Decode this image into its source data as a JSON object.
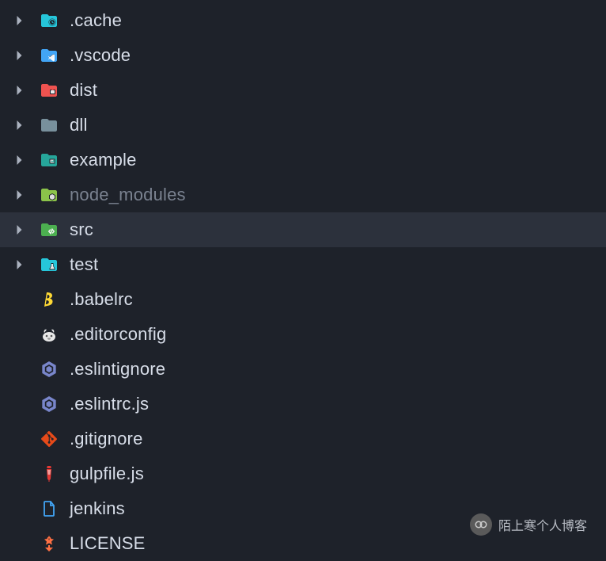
{
  "files": [
    {
      "name": ".cache",
      "type": "folder",
      "icon": "folder-clock",
      "color": "#26c6da",
      "expandable": true,
      "dimmed": false
    },
    {
      "name": ".vscode",
      "type": "folder",
      "icon": "folder-vscode",
      "color": "#42a5f5",
      "expandable": true,
      "dimmed": false
    },
    {
      "name": "dist",
      "type": "folder",
      "icon": "folder-dist",
      "color": "#ef5350",
      "expandable": true,
      "dimmed": false
    },
    {
      "name": "dll",
      "type": "folder",
      "icon": "folder",
      "color": "#78909c",
      "expandable": true,
      "dimmed": false
    },
    {
      "name": "example",
      "type": "folder",
      "icon": "folder-example",
      "color": "#26a69a",
      "expandable": true,
      "dimmed": false
    },
    {
      "name": "node_modules",
      "type": "folder",
      "icon": "folder-node",
      "color": "#8bc34a",
      "expandable": true,
      "dimmed": true
    },
    {
      "name": "src",
      "type": "folder",
      "icon": "folder-src",
      "color": "#4caf50",
      "expandable": true,
      "selected": true,
      "dimmed": false
    },
    {
      "name": "test",
      "type": "folder",
      "icon": "folder-test",
      "color": "#26c6da",
      "expandable": true,
      "dimmed": false
    },
    {
      "name": ".babelrc",
      "type": "file",
      "icon": "babel",
      "color": "#fdd835",
      "expandable": false,
      "dimmed": false
    },
    {
      "name": ".editorconfig",
      "type": "file",
      "icon": "editorconfig",
      "color": "#e8e8e8",
      "expandable": false,
      "dimmed": false
    },
    {
      "name": ".eslintignore",
      "type": "file",
      "icon": "eslint",
      "color": "#7986cb",
      "expandable": false,
      "dimmed": false
    },
    {
      "name": ".eslintrc.js",
      "type": "file",
      "icon": "eslint",
      "color": "#7986cb",
      "expandable": false,
      "dimmed": false
    },
    {
      "name": ".gitignore",
      "type": "file",
      "icon": "git",
      "color": "#e64a19",
      "expandable": false,
      "dimmed": false
    },
    {
      "name": "gulpfile.js",
      "type": "file",
      "icon": "gulp",
      "color": "#e53935",
      "expandable": false,
      "dimmed": false
    },
    {
      "name": "jenkins",
      "type": "file",
      "icon": "file",
      "color": "#42a5f5",
      "expandable": false,
      "dimmed": false
    },
    {
      "name": "LICENSE",
      "type": "file",
      "icon": "license",
      "color": "#ff7043",
      "expandable": false,
      "dimmed": false
    }
  ],
  "watermark": {
    "text": "陌上寒个人博客"
  }
}
